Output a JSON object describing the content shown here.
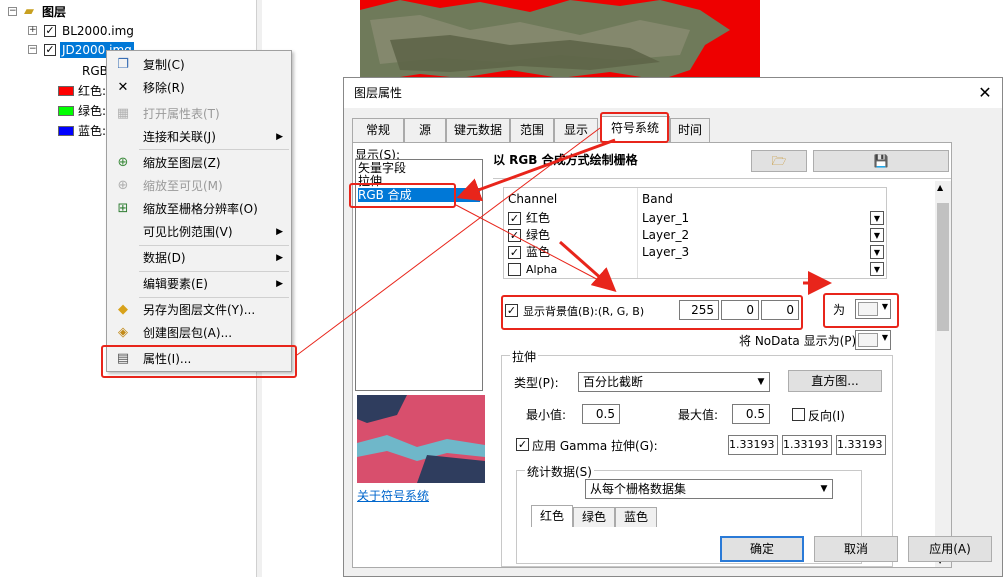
{
  "toc": {
    "root_label": "图层",
    "layers": [
      {
        "name": "BL2000.img"
      },
      {
        "name": "JD2000.img"
      }
    ],
    "rgb_label": "RGB",
    "bands": [
      {
        "label": "红色:",
        "color": "#ff0000"
      },
      {
        "label": "绿色:",
        "color": "#00ff00"
      },
      {
        "label": "蓝色:",
        "color": "#0000ff"
      }
    ]
  },
  "context_menu": {
    "items": [
      {
        "label": "复制(C)",
        "icon": "copy-icon",
        "disabled": false,
        "submenu": false
      },
      {
        "label": "移除(R)",
        "icon": "remove-icon",
        "disabled": false,
        "submenu": false
      },
      {
        "label": "打开属性表(T)",
        "icon": "table-icon",
        "disabled": true,
        "submenu": false
      },
      {
        "label": "连接和关联(J)",
        "icon": "",
        "disabled": false,
        "submenu": true
      },
      {
        "label": "缩放至图层(Z)",
        "icon": "zoom-layer-icon",
        "disabled": false,
        "submenu": false
      },
      {
        "label": "缩放至可见(M)",
        "icon": "zoom-visible-icon",
        "disabled": true,
        "submenu": false
      },
      {
        "label": "缩放至栅格分辨率(O)",
        "icon": "zoom-raster-icon",
        "disabled": false,
        "submenu": false
      },
      {
        "label": "可见比例范围(V)",
        "icon": "",
        "disabled": false,
        "submenu": true
      },
      {
        "label": "数据(D)",
        "icon": "",
        "disabled": false,
        "submenu": true
      },
      {
        "label": "编辑要素(E)",
        "icon": "",
        "disabled": false,
        "submenu": true
      },
      {
        "label": "另存为图层文件(Y)...",
        "icon": "layer-file-icon",
        "disabled": false,
        "submenu": false
      },
      {
        "label": "创建图层包(A)...",
        "icon": "layer-package-icon",
        "disabled": false,
        "submenu": false
      },
      {
        "label": "属性(I)...",
        "icon": "properties-icon",
        "disabled": false,
        "submenu": false
      }
    ]
  },
  "dialog": {
    "title": "图层属性",
    "close_glyph": "✕",
    "tabs": [
      "常规",
      "源",
      "键元数据",
      "范围",
      "显示",
      "符号系统",
      "时间"
    ],
    "active_tab": "符号系统",
    "show_label": "显示(S):",
    "show_list": [
      "矢量字段",
      "拉伸",
      "RGB 合成"
    ],
    "selected_show": "RGB 合成",
    "about_link": "关于符号系统",
    "heading": "以 RGB 合成方式绘制栅格",
    "grid_headers": [
      "Channel",
      "Band"
    ],
    "channels": [
      {
        "label": "红色",
        "checked": true,
        "band": "Layer_1"
      },
      {
        "label": "绿色",
        "checked": true,
        "band": "Layer_2"
      },
      {
        "label": "蓝色",
        "checked": true,
        "band": "Layer_3"
      },
      {
        "label": "Alpha",
        "checked": false,
        "band": ""
      }
    ],
    "background": {
      "label": "显示背景值(B):(R, G, B)",
      "checked": true,
      "r": "255",
      "g": "0",
      "b": "0",
      "as_label": "为"
    },
    "nodata_label": "将 NoData 显示为(P)",
    "stretch": {
      "group_label": "拉伸",
      "type_label": "类型(P):",
      "type_value": "百分比截断",
      "histogram_button": "直方图...",
      "min_label": "最小值:",
      "min_value": "0.5",
      "max_label": "最大值:",
      "max_value": "0.5",
      "invert_label": "反向(I)",
      "gamma_label": "应用 Gamma 拉伸(G):",
      "gamma_values": [
        "1.33193",
        "1.33193",
        "1.33193"
      ],
      "stats_label": "统计数据(S)",
      "stats_value": "从每个栅格数据集",
      "stats_tabs": [
        "红色",
        "绿色",
        "蓝色"
      ]
    },
    "buttons": {
      "ok": "确定",
      "cancel": "取消",
      "apply": "应用(A)"
    }
  },
  "colors": {
    "annotation_red": "#e8251b",
    "selection_blue": "#0078d7",
    "map_background": "#ee0000"
  }
}
